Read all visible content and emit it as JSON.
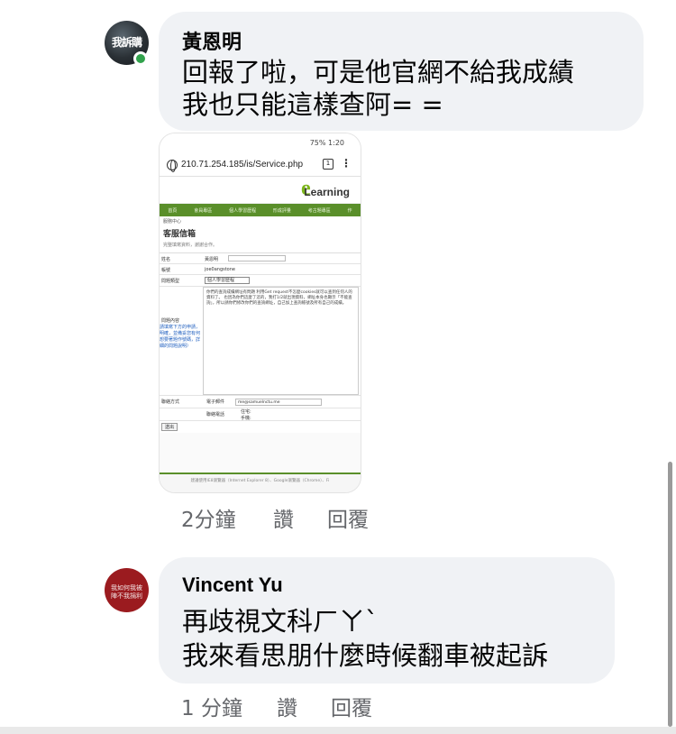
{
  "comments": [
    {
      "author": "黃恩明",
      "avatar_text": "我訴購",
      "online": true,
      "lines": [
        "回報了啦，可是他官網不給我成績",
        "我也只能這樣查阿= ="
      ],
      "time": "2分鐘",
      "like_label": "讚",
      "reply_label": "回覆",
      "attachment": {
        "status_bar": "75% 1:20",
        "url": "210.71.254.185/is/Service.php",
        "tab_count": "1",
        "logo_letter": "e",
        "logo_text": "Learning",
        "nav_items": [
          "首頁",
          "會員專區",
          "個人學習歷程",
          "形成評量",
          "考古題專區",
          "作"
        ],
        "breadcrumb": "服務中心",
        "page_title": "客服信箱",
        "note": "完整填寫資料，謝謝合作。",
        "form": {
          "name_label": "姓名",
          "name_value": "黃恩明",
          "account_label": "帳號",
          "account_value": "joe0angstone",
          "type_label": "問題類型",
          "type_value": "個人學習歷程",
          "content_label": "問題內容",
          "content_text": "你們的查詢成績網址有問題 利用Get request不怎麼cookies就可以查到任何人的資料了。 也因為你們這麼了這的，我打1/2就出現資料，網址本身也顯示「不能查詢」，所以請你們修改你們的查詢網址，自己加上查詢帳號及所有自己的成績。",
          "content_hint": "請填寫下方的申請，明確，並備妥您有何想要著題作號碼，詳細的問題說明）",
          "email_label": "電子郵件",
          "email_value": "me@samuelnctu.me",
          "phone_label": "聯絡電話",
          "phone_home": "住宅:",
          "phone_mobile": "手機:",
          "contact_label": "聯絡方式",
          "submit_label": "送出"
        },
        "footer": "建議使用IE8瀏覽器（Internet Explorer 8）、Google瀏覽器（Chrome）、Fi"
      }
    },
    {
      "author": "Vincent Yu",
      "avatar_text": [
        "我如何我被",
        "陣不我捐利"
      ],
      "online": false,
      "lines": [
        "再歧視文科ㄏㄚˋ",
        "我來看思朋什麼時候翻車被起訴"
      ],
      "time": "1 分鐘",
      "like_label": "讚",
      "reply_label": "回覆"
    }
  ],
  "colors": {
    "bubble": "#f0f2f5",
    "meta": "#65676b",
    "online": "#31a24c",
    "elearning_green": "#5a8f2a"
  }
}
